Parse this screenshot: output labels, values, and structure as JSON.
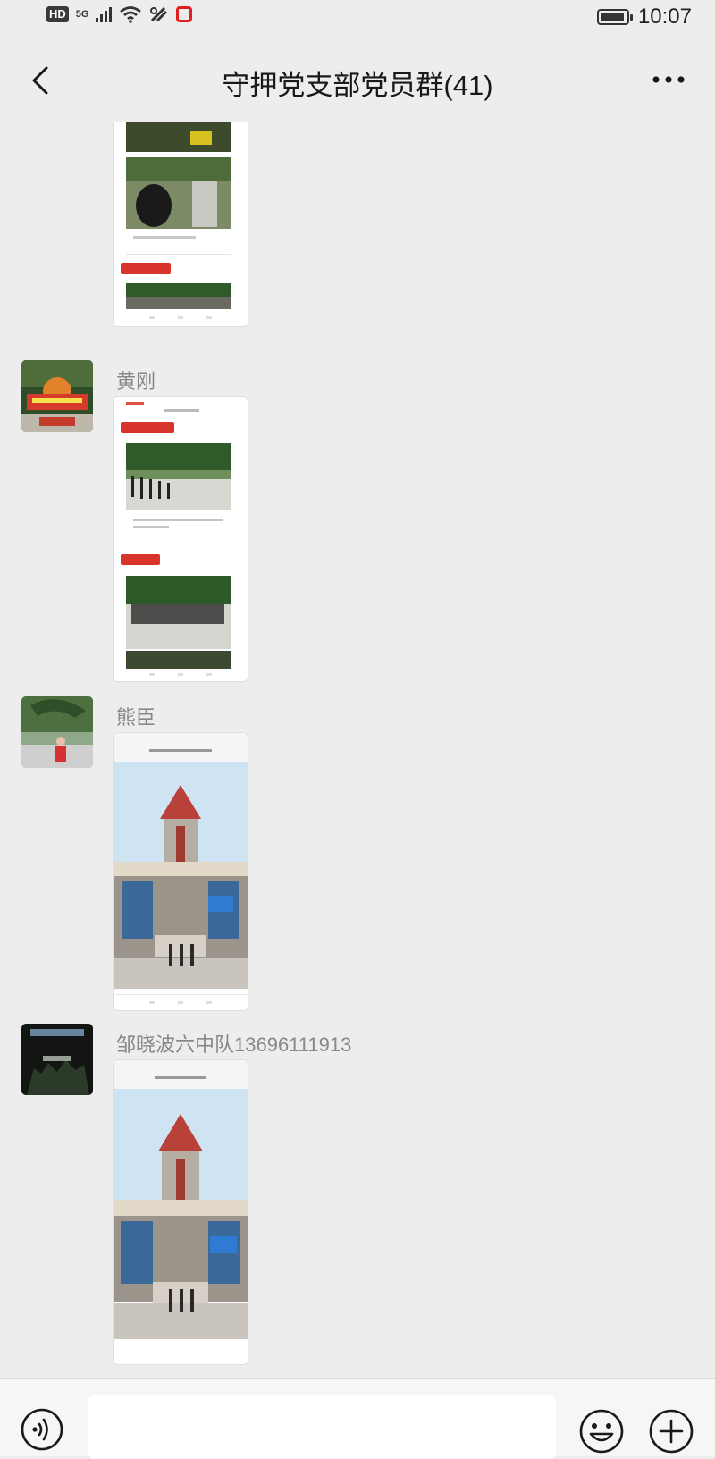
{
  "status_bar": {
    "hd_label": "HD",
    "network_label": "5G",
    "time": "10:07"
  },
  "header": {
    "title": "守押党支部党员群(41)"
  },
  "messages": [
    {
      "sender": "黄刚",
      "content": "shared-image"
    },
    {
      "sender": "熊臣",
      "content": "shared-image"
    },
    {
      "sender": "邹晓波六中队13696111913",
      "content": "shared-image"
    }
  ],
  "input_bar": {
    "placeholder": ""
  },
  "icons": {
    "back": "back-arrow-icon",
    "more": "more-icon",
    "voice": "voice-icon",
    "emoji": "emoji-icon",
    "plus": "plus-icon"
  },
  "colors": {
    "background": "#ededed",
    "bottom_bar": "#f6f6f6",
    "status_red": "#e02020"
  }
}
